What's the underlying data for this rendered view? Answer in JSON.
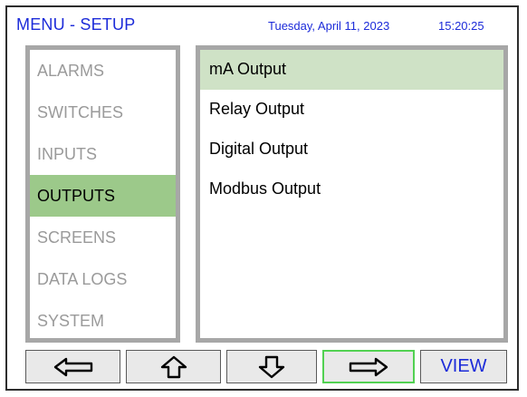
{
  "header": {
    "title": "MENU - SETUP",
    "date": "Tuesday, April 11, 2023",
    "time": "15:20:25"
  },
  "menu": {
    "items": [
      {
        "label": "ALARMS",
        "selected": false
      },
      {
        "label": "SWITCHES",
        "selected": false
      },
      {
        "label": "INPUTS",
        "selected": false
      },
      {
        "label": "OUTPUTS",
        "selected": true
      },
      {
        "label": "SCREENS",
        "selected": false
      },
      {
        "label": "DATA LOGS",
        "selected": false
      },
      {
        "label": "SYSTEM",
        "selected": false
      }
    ]
  },
  "submenu": {
    "items": [
      {
        "label": "mA Output",
        "selected": true
      },
      {
        "label": "Relay Output",
        "selected": false
      },
      {
        "label": "Digital Output",
        "selected": false
      },
      {
        "label": "Modbus Output",
        "selected": false
      }
    ]
  },
  "buttons": {
    "back_icon": "arrow-left-icon",
    "up_icon": "arrow-up-icon",
    "down_icon": "arrow-down-icon",
    "enter_icon": "arrow-right-icon",
    "view_label": "VIEW"
  },
  "colors": {
    "accent_text": "#1c2bd9",
    "selected_menu_bg": "#9cc98a",
    "selected_submenu_bg": "#cfe2c6",
    "inactive_text": "#9a9a9a",
    "focus_border": "#52d152"
  }
}
